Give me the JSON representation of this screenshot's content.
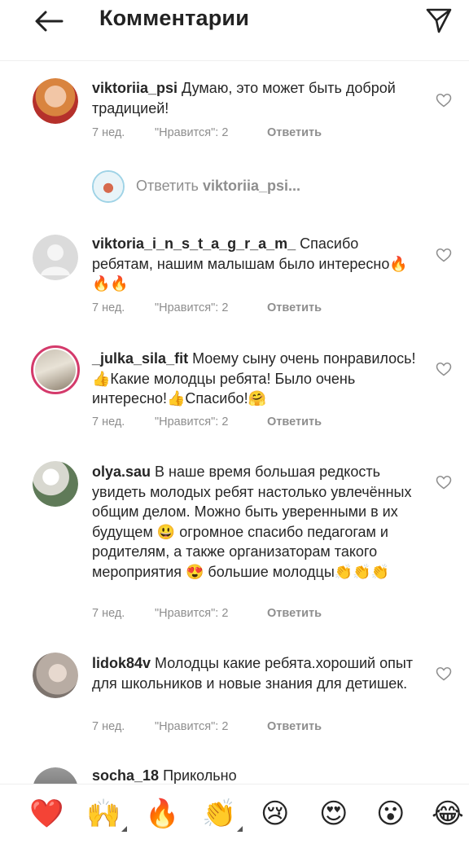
{
  "header": {
    "title": "Комментарии"
  },
  "comments": [
    {
      "user": "viktoriia_psi",
      "text": " Думаю, это может быть доброй традицией!",
      "time": "7 нед.",
      "likes": "\"Нравится\": 2",
      "reply": "Ответить"
    },
    {
      "user": "viktoria_i_n_s_t_a_g_r_a_m_",
      "text": " Спасибо ребятам, нашим малышам было интересно🔥🔥🔥",
      "time": "7 нед.",
      "likes": "\"Нравится\": 2",
      "reply": "Ответить"
    },
    {
      "user": "_julka_sila_fit",
      "text": " Моему сыну очень понравилось!👍Какие молодцы ребята! Было очень интересно!👍Спасибо!🤗",
      "time": "7 нед.",
      "likes": "\"Нравится\": 2",
      "reply": "Ответить"
    },
    {
      "user": "olya.sau",
      "text": " В наше время большая редкость увидеть молодых ребят настолько увлечённых общим  делом. Можно быть уверенными в их будущем 😃 огромное спасибо педагогам и родителям, а также организаторам такого мероприятия 😍 большие молодцы👏👏👏",
      "time": "7 нед.",
      "likes": "\"Нравится\": 2",
      "reply": "Ответить"
    },
    {
      "user": "lidok84v",
      "text": " Молодцы какие ребята.хороший опыт для школьников и новые знания для детишек.",
      "time": "7 нед.",
      "likes": "\"Нравится\": 2",
      "reply": "Ответить"
    },
    {
      "user": "socha_18",
      "text": " Прикольно"
    }
  ],
  "reply_prompt": {
    "prefix": "Ответить ",
    "user": "viktoriia_psi..."
  },
  "emoji_bar": [
    "❤️",
    "🙌",
    "🔥",
    "👏",
    "😢",
    "😍",
    "😮",
    "😂"
  ],
  "colors": {
    "text": "#262626",
    "meta": "#8e8e8e",
    "story_ring": "#d43a6b"
  }
}
